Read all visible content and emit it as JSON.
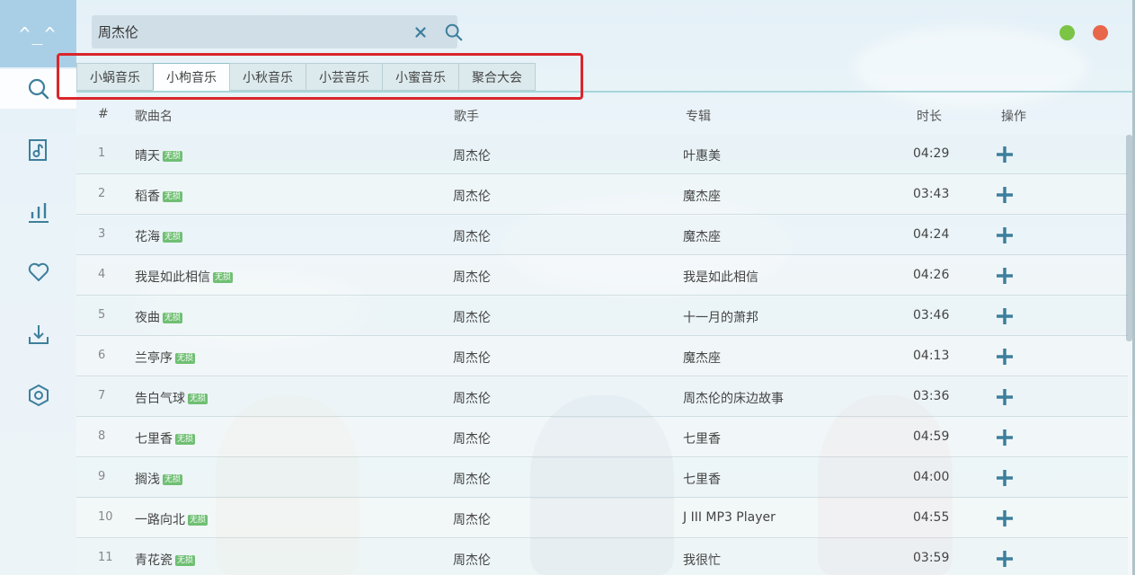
{
  "app": {
    "logo_text": "^_^"
  },
  "sidebar": {
    "icons": [
      "search-icon",
      "music-file-icon",
      "chart-icon",
      "heart-icon",
      "download-icon",
      "settings-icon"
    ]
  },
  "search": {
    "value": "周杰伦",
    "placeholder": ""
  },
  "window_controls": {
    "minimize_color": "#7cc445",
    "close_color": "#e8674b"
  },
  "tabs": [
    {
      "label": "小蜗音乐"
    },
    {
      "label": "小枸音乐",
      "active": true
    },
    {
      "label": "小秋音乐"
    },
    {
      "label": "小芸音乐"
    },
    {
      "label": "小蜜音乐"
    },
    {
      "label": "聚合大会"
    }
  ],
  "table": {
    "headers": {
      "index": "#",
      "name": "歌曲名",
      "artist": "歌手",
      "album": "专辑",
      "duration": "时长",
      "action": "操作"
    },
    "badge": "无损",
    "rows": [
      {
        "index": "1",
        "name": "晴天",
        "artist": "周杰伦",
        "album": "叶惠美",
        "duration": "04:29"
      },
      {
        "index": "2",
        "name": "稻香",
        "artist": "周杰伦",
        "album": "魔杰座",
        "duration": "03:43"
      },
      {
        "index": "3",
        "name": "花海",
        "artist": "周杰伦",
        "album": "魔杰座",
        "duration": "04:24"
      },
      {
        "index": "4",
        "name": "我是如此相信",
        "artist": "周杰伦",
        "album": "我是如此相信",
        "duration": "04:26"
      },
      {
        "index": "5",
        "name": "夜曲",
        "artist": "周杰伦",
        "album": "十一月的萧邦",
        "duration": "03:46"
      },
      {
        "index": "6",
        "name": "兰亭序",
        "artist": "周杰伦",
        "album": "魔杰座",
        "duration": "04:13"
      },
      {
        "index": "7",
        "name": "告白气球",
        "artist": "周杰伦",
        "album": "周杰伦的床边故事",
        "duration": "03:36"
      },
      {
        "index": "8",
        "name": "七里香",
        "artist": "周杰伦",
        "album": "七里香",
        "duration": "04:59"
      },
      {
        "index": "9",
        "name": "搁浅",
        "artist": "周杰伦",
        "album": "七里香",
        "duration": "04:00"
      },
      {
        "index": "10",
        "name": "一路向北",
        "artist": "周杰伦",
        "album": "J III MP3 Player",
        "duration": "04:55"
      },
      {
        "index": "11",
        "name": "青花瓷",
        "artist": "周杰伦",
        "album": "我很忙",
        "duration": "03:59"
      }
    ]
  },
  "colors": {
    "accent": "#3d7f9c",
    "badge": "#6fbf73",
    "highlight": "#d9262c"
  }
}
